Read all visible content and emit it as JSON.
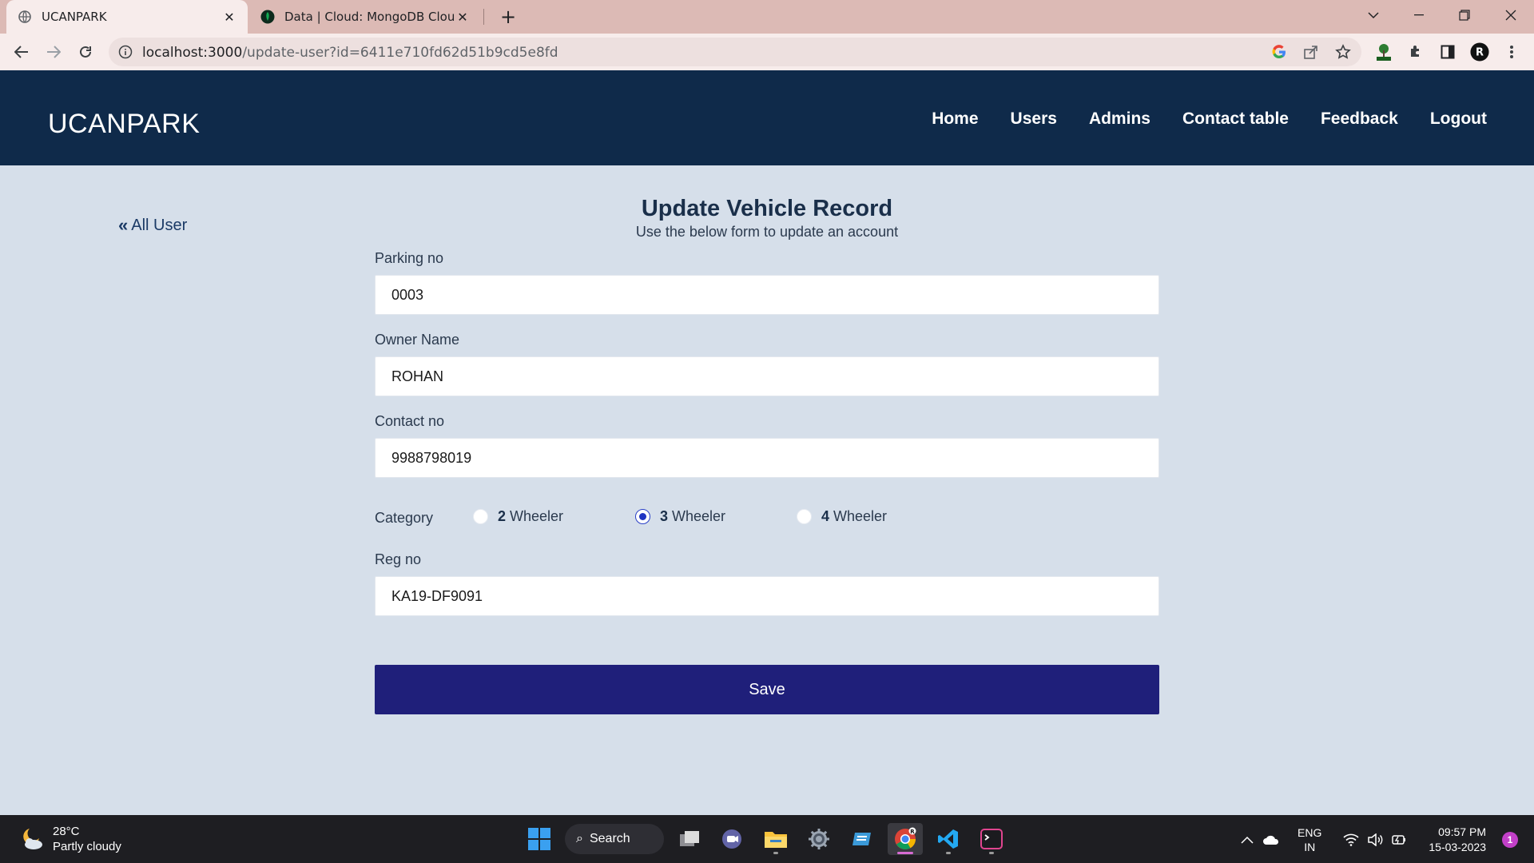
{
  "browser": {
    "tabs": [
      {
        "title": "UCANPARK",
        "active": true
      },
      {
        "title": "Data | Cloud: MongoDB Cloud",
        "active": false
      }
    ],
    "url_host": "localhost:3000",
    "url_path": "/update-user?id=6411e710fd62d51b9cd5e8fd",
    "profile_initial": "R"
  },
  "app": {
    "brand": "UCANPARK",
    "nav": [
      "Home",
      "Users",
      "Admins",
      "Contact table",
      "Feedback",
      "Logout"
    ]
  },
  "page": {
    "back_link": "All User",
    "title": "Update Vehicle Record",
    "subtitle": "Use the below form to update an account"
  },
  "form": {
    "parking_label": "Parking no",
    "parking_value": "0003",
    "owner_label": "Owner Name",
    "owner_value": "ROHAN",
    "contact_label": "Contact no",
    "contact_value": "9988798019",
    "category_label": "Category",
    "categories": [
      {
        "num": "2",
        "label": "Wheeler",
        "checked": false
      },
      {
        "num": "3",
        "label": "Wheeler",
        "checked": true
      },
      {
        "num": "4",
        "label": "Wheeler",
        "checked": false
      }
    ],
    "reg_label": "Reg no",
    "reg_value": "KA19-DF9091",
    "save_label": "Save"
  },
  "taskbar": {
    "temperature": "28°C",
    "weather": "Partly cloudy",
    "search_label": "Search",
    "lang_top": "ENG",
    "lang_bottom": "IN",
    "time": "09:57 PM",
    "date": "15-03-2023",
    "notification_count": "1"
  },
  "colors": {
    "navbar": "#0f2a4a",
    "page_bg": "#d6dfea",
    "save_button": "#1f1f7a",
    "radio_checked": "#1f34c2"
  }
}
